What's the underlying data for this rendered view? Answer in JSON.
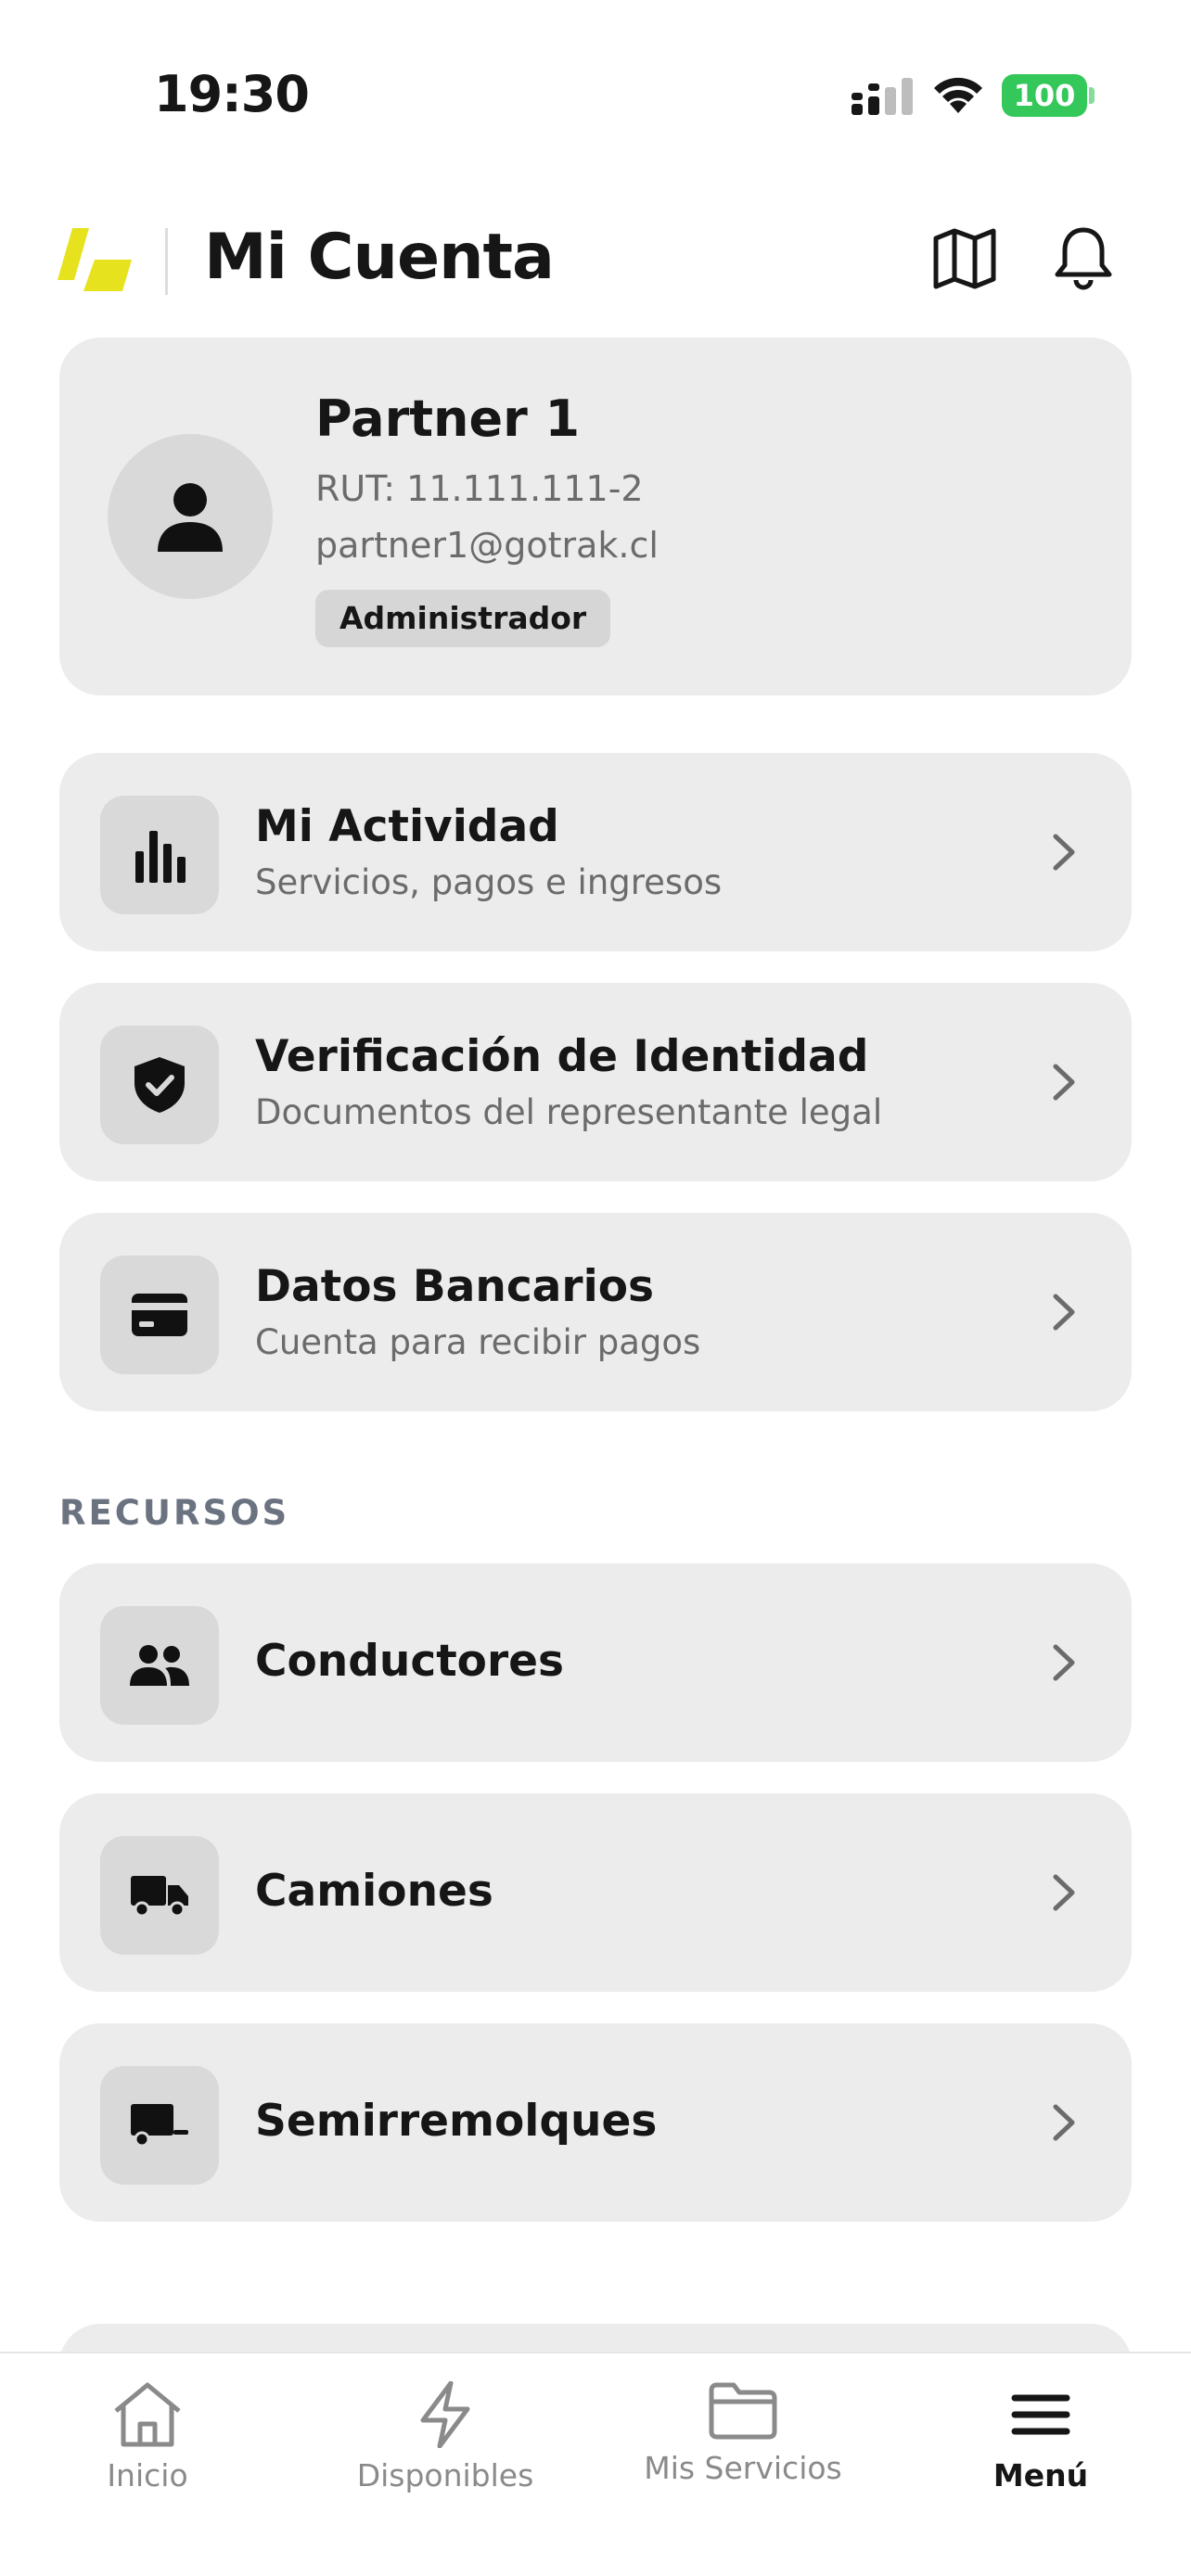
{
  "status_bar": {
    "time": "19:30",
    "battery": "100"
  },
  "header": {
    "title": "Mi Cuenta"
  },
  "profile": {
    "name": "Partner 1",
    "rut": "RUT: 11.111.111-2",
    "email": "partner1@gotrak.cl",
    "role": "Administrador"
  },
  "account_items": [
    {
      "title": "Mi Actividad",
      "subtitle": "Servicios, pagos e ingresos",
      "icon": "bar-chart-icon"
    },
    {
      "title": "Verificación de Identidad",
      "subtitle": "Documentos del representante legal",
      "icon": "shield-check-icon"
    },
    {
      "title": "Datos Bancarios",
      "subtitle": "Cuenta para recibir pagos",
      "icon": "credit-card-icon"
    }
  ],
  "resources": {
    "label": "RECURSOS",
    "items": [
      {
        "title": "Conductores",
        "icon": "people-icon"
      },
      {
        "title": "Camiones",
        "icon": "truck-icon"
      },
      {
        "title": "Semirremolques",
        "icon": "trailer-icon"
      }
    ]
  },
  "bottom_nav": [
    {
      "label": "Inicio",
      "icon": "home-icon",
      "active": false
    },
    {
      "label": "Disponibles",
      "icon": "bolt-icon",
      "active": false
    },
    {
      "label": "Mis Servicios",
      "icon": "folder-icon",
      "active": false
    },
    {
      "label": "Menú",
      "icon": "menu-icon",
      "active": true
    }
  ],
  "colors": {
    "brand": "#e6e21e",
    "card": "#ececec",
    "battery": "#34c759",
    "muted": "#6b6b6b"
  }
}
